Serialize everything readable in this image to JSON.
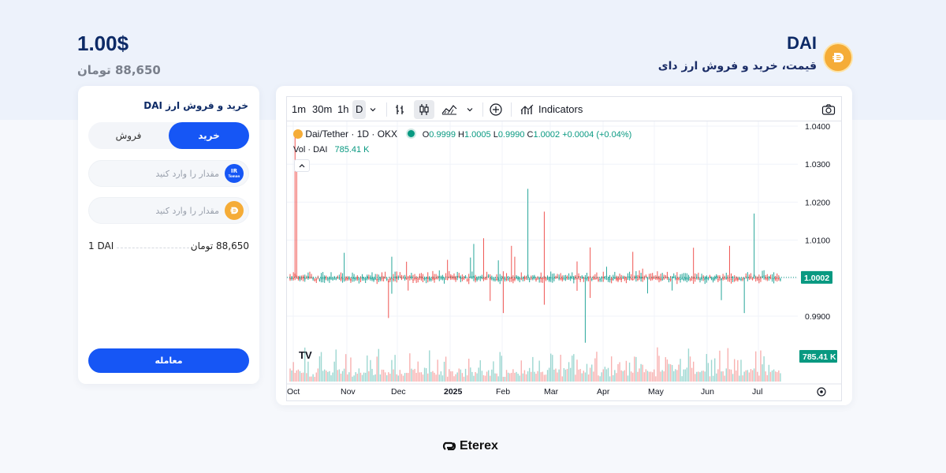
{
  "header": {
    "coin_symbol": "DAI",
    "coin_subtitle": "قیمت، خرید و فروش ارز دای",
    "price_usd": "1.00$",
    "price_toman": "88,650 تومان",
    "coin_logo_icon": "dai-coin-icon"
  },
  "trade": {
    "title": "خرید و فروش ارز DAI",
    "tab_buy": "خرید",
    "tab_sell": "فروش",
    "toman_field_placeholder": "مقدار را وارد کنید",
    "toman_icon_text": "IR",
    "toman_icon_sub": "Toman",
    "dai_field_placeholder": "مقدار را وارد کنید",
    "rate_left": "1 DAI",
    "rate_right": "88,650 تومان",
    "trade_button": "معامله"
  },
  "chart_toolbar": {
    "intervals": [
      "1m",
      "30m",
      "1h",
      "D"
    ],
    "active_interval": "D",
    "indicators_label": "Indicators",
    "icons": [
      "chevron-down-icon",
      "bar-chart-icon",
      "candles-icon",
      "area-chart-icon",
      "add-circle-icon",
      "indicators-icon",
      "camera-icon"
    ]
  },
  "chart_legend": {
    "symbol": "Dai/Tether · 1D · OKX",
    "o_label": "O",
    "o_value": "0.9999",
    "h_label": "H",
    "h_value": "1.0005",
    "l_label": "L",
    "l_value": "0.9990",
    "c_label": "C",
    "c_value": "1.0002",
    "change": "+0.0004 (+0.04%)",
    "vol_label": "Vol · DAI",
    "vol_value": "785.41 K",
    "tv_logo": "TV"
  },
  "colors": {
    "up": "#26a69a",
    "down": "#ef5350",
    "accent_blue": "#1656f5",
    "dai_gold": "#f5ac37",
    "price_tag": "#089981"
  },
  "chart_data": {
    "type": "candlestick",
    "x_ticks": [
      "Oct",
      "Nov",
      "Dec",
      "2025",
      "Feb",
      "Mar",
      "Apr",
      "May",
      "Jun",
      "Jul"
    ],
    "y_ticks": [
      "1.0400",
      "1.0300",
      "1.0200",
      "1.0100",
      "1.0000",
      "0.9900"
    ],
    "ylim": [
      0.985,
      1.041
    ],
    "last_price_label": "1.0002",
    "last_volume_label": "785.41 K",
    "baseline": 1.0,
    "notable_spikes": [
      {
        "x": "Oct",
        "high": 1.0375,
        "low": 0.9995
      },
      {
        "x": "Dec",
        "high": 1.0235,
        "low": 0.9935
      },
      {
        "x": "Jan",
        "high": 1.0005,
        "low": 0.982
      },
      {
        "x": "Jul",
        "high": 1.017,
        "low": 0.9995
      }
    ]
  }
}
